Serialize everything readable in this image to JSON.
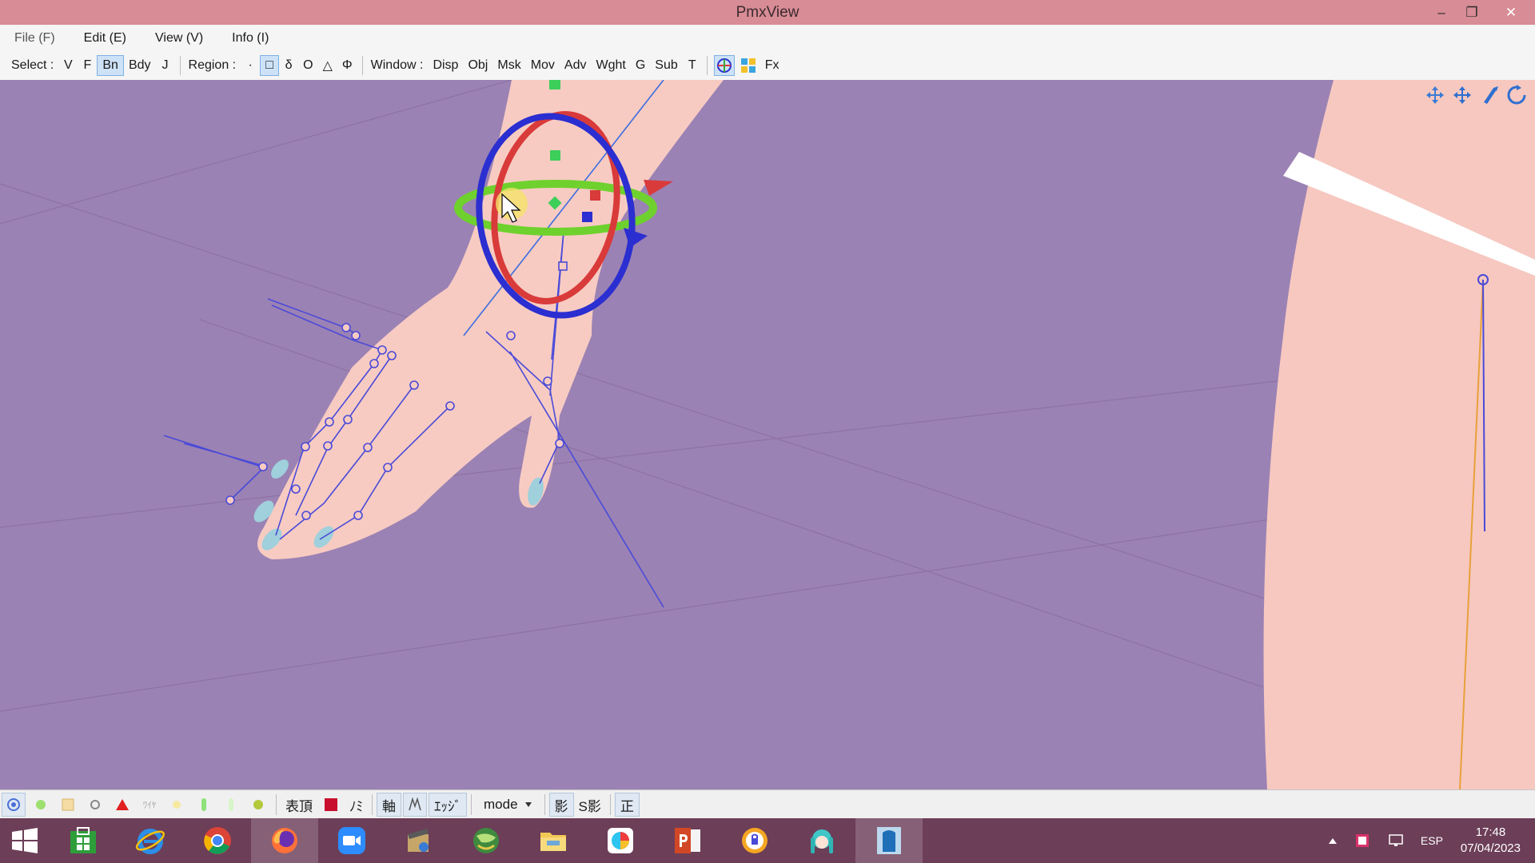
{
  "window": {
    "title": "PmxView"
  },
  "window_controls": {
    "minimize": "–",
    "restore": "❐",
    "close": "✕"
  },
  "menu": [
    "File (F)",
    "Edit (E)",
    "View (V)",
    "Info (I)"
  ],
  "toolbar": {
    "select_label": "Select :",
    "select_buttons": [
      "V",
      "F",
      "Bn",
      "Bdy",
      "J"
    ],
    "select_active": "Bn",
    "region_label": "Region :",
    "region_buttons": [
      "·",
      "□",
      "δ",
      "O",
      "△",
      "Φ"
    ],
    "region_active": "□",
    "window_label": "Window :",
    "window_buttons": [
      "Disp",
      "Obj",
      "Msk",
      "Mov",
      "Adv",
      "Wght",
      "G",
      "Sub",
      "T"
    ],
    "fx_label": "Fx"
  },
  "bottom_toolbar": {
    "jp_labels": [
      "表頂",
      "ﾉﾐ",
      "軸",
      "ｴｯｼﾞ"
    ],
    "wire_label": "ﾜｲﾔ",
    "mode_label": "mode",
    "shadow1": "影",
    "shadow2": "S影",
    "front_label": "正"
  },
  "taskbar": {
    "apps": [
      "store",
      "internet-explorer",
      "chrome",
      "firefox",
      "zoom",
      "movie-maker",
      "globe-app",
      "file-explorer",
      "paint",
      "powerpoint",
      "vpn",
      "miku",
      "pmx-editor"
    ],
    "tray": {
      "language": "ESP",
      "time": "17:48",
      "date": "07/04/2023"
    }
  },
  "colors": {
    "titlebar": "#d88c96",
    "viewport": "#9b82b4",
    "taskbar": "#6c3e58",
    "gizmo_blue": "#2b2ed0",
    "gizmo_red": "#d93a3a",
    "gizmo_green": "#6fd12e",
    "bone_line": "#4a4ad8"
  }
}
